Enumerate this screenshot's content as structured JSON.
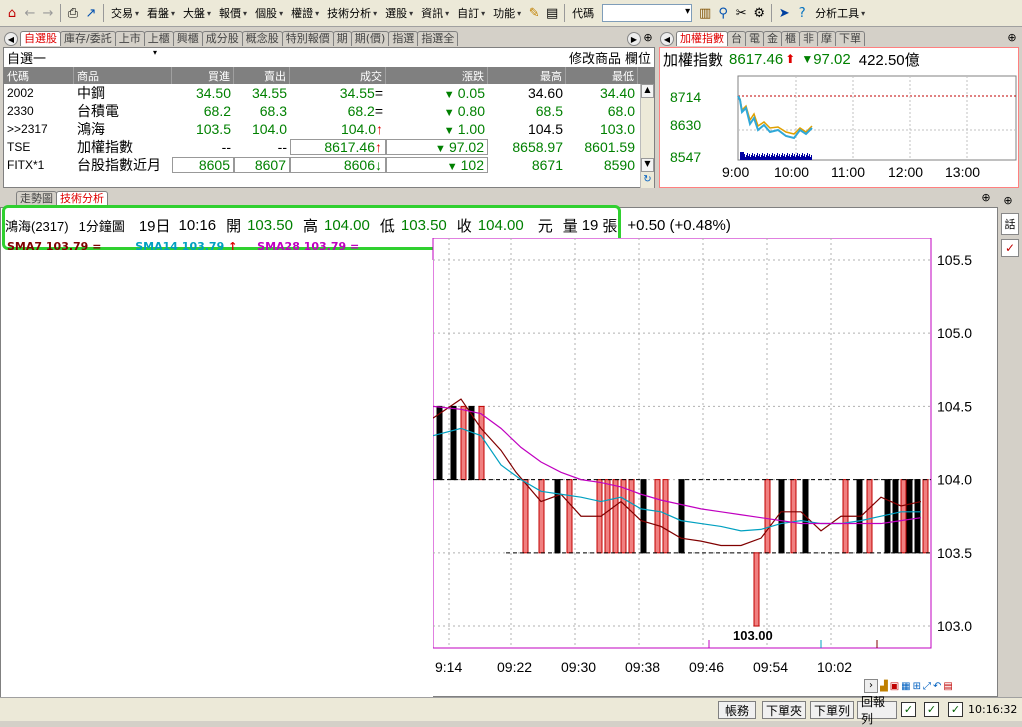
{
  "toolbar": {
    "menus": [
      "交易",
      "看盤",
      "大盤",
      "報價",
      "個股",
      "權證",
      "技術分析",
      "選股",
      "資訊",
      "自訂",
      "功能"
    ],
    "code_label": "代碼",
    "analysis_tools": "分析工具"
  },
  "quote_tabs": [
    "自選股",
    "庫存/委託",
    "上市",
    "上櫃",
    "興櫃",
    "成分股",
    "概念股",
    "特別報價",
    "期",
    "期(價)",
    "指選",
    "指選全"
  ],
  "quote_panel": {
    "list_name": "自選一",
    "modify_label": "修改商品",
    "fields_label": "欄位",
    "columns": [
      "代碼",
      "商品",
      "買進",
      "賣出",
      "成交",
      "漲跌",
      "最高",
      "最低"
    ],
    "rows": [
      {
        "code": "2002",
        "name": "中鋼",
        "bid": "34.50",
        "ask": "34.55",
        "last": "34.55",
        "mark": "=",
        "change": "0.05",
        "high": "34.60",
        "low": "34.40"
      },
      {
        "code": "2330",
        "name": "台積電",
        "bid": "68.2",
        "ask": "68.3",
        "last": "68.2",
        "mark": "=",
        "change": "0.80",
        "high": "68.5",
        "low": "68.0"
      },
      {
        "code": ">>2317",
        "name": "鴻海",
        "bid": "103.5",
        "ask": "104.0",
        "last": "104.0",
        "mark": "↑",
        "change": "1.00",
        "high": "104.5",
        "low": "103.0"
      },
      {
        "code": "TSE",
        "name": "加權指數",
        "bid": "--",
        "ask": "--",
        "last": "8617.46",
        "mark": "↑",
        "change": "97.02",
        "high": "8658.97",
        "low": "8601.59"
      },
      {
        "code": "FITX*1",
        "name": "台股指數近月",
        "bid": "8605",
        "ask": "8607",
        "last": "8606",
        "mark": "↓",
        "change": "102",
        "high": "8671",
        "low": "8590"
      }
    ]
  },
  "index_tabs": [
    "加權指數",
    "台",
    "電",
    "金",
    "櫃",
    "非",
    "摩",
    "下單"
  ],
  "index_panel": {
    "name": "加權指數",
    "value": "8617.46",
    "change": "97.02",
    "volume": "422.50億",
    "y_ticks": [
      "8714",
      "8630",
      "8547"
    ],
    "x_ticks": [
      "9:00",
      "10:00",
      "11:00",
      "12:00",
      "13:00"
    ]
  },
  "tech_tabs": [
    "走勢圖",
    "技術分析"
  ],
  "tech_header": {
    "stock": "鴻海(2317)",
    "period": "1分鐘圖",
    "date": "19日",
    "time": "10:16",
    "open_label": "開",
    "open": "103.50",
    "high_label": "高",
    "high": "104.00",
    "low_label": "低",
    "low": "103.50",
    "close_label": "收",
    "close": "104.00",
    "unit": "元",
    "vol_label": "量",
    "vol": "19",
    "vol_unit": "張",
    "change": "+0.50 (+0.48%)"
  },
  "sma": [
    {
      "label": "SMA7",
      "value": "103.79",
      "mark": "="
    },
    {
      "label": "SMA14",
      "value": "103.79",
      "mark": "↑"
    },
    {
      "label": "SMA28",
      "value": "103.79",
      "mark": "="
    }
  ],
  "chart_data": {
    "type": "bar",
    "y_ticks": [
      "105.5",
      "105.0",
      "104.5",
      "104.0",
      "103.5",
      "103.0"
    ],
    "x_ticks": [
      "9:14",
      "09:22",
      "09:30",
      "09:38",
      "09:46",
      "09:54",
      "10:02"
    ],
    "ylim": [
      102.85,
      105.65
    ],
    "low_annotation": "103.00",
    "series": [
      {
        "name": "SMA7",
        "color": "#800000"
      },
      {
        "name": "SMA14",
        "color": "#00a0c0"
      },
      {
        "name": "SMA28",
        "color": "#c000c0"
      }
    ]
  },
  "statusbar": {
    "buttons": [
      "帳務",
      "下單夾",
      "下單列",
      "回報列"
    ],
    "clock": "10:16:32"
  },
  "colors": {
    "up": "#e00000",
    "down": "#008000",
    "highlight_box": "#30d030"
  }
}
